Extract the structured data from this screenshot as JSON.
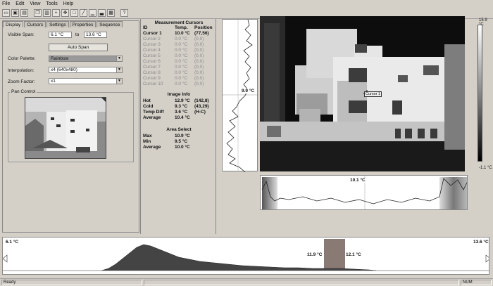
{
  "menu": [
    "File",
    "Edit",
    "View",
    "Tools",
    "Help"
  ],
  "toolbar_icons": [
    "open-icon",
    "save-icon",
    "print-icon",
    "copy-icon",
    "paste-icon",
    "cursor-add-icon",
    "cursor-move-icon",
    "rectangle-icon",
    "line-icon",
    "histogram-icon",
    "histogram-2-icon",
    "palette-icon",
    "help-icon"
  ],
  "tabs": [
    "Display",
    "Cursors",
    "Settings",
    "Properties",
    "Sequence"
  ],
  "display": {
    "visible_span_label": "Visible Span:",
    "span_min": "6.1 °C",
    "to_label": "to",
    "span_max": "13.6 °C",
    "auto_span": "Auto Span",
    "color_palette_label": "Color Palette:",
    "color_palette": "Rainbow",
    "interpolation_label": "Interpolation:",
    "interpolation": "x4 (640x480)",
    "zoom_label": "Zoom Factor:",
    "zoom": "x1",
    "pan_control": "Pan Control"
  },
  "measurement": {
    "title": "Measurement Cursors",
    "headers": [
      "ID",
      "Temp.",
      "Position"
    ],
    "cursors": [
      {
        "id": "Cursor 1",
        "temp": "10.0 °C",
        "pos": "(77,56)",
        "active": true
      },
      {
        "id": "Cursor 2",
        "temp": "0.0 °C",
        "pos": "(0,0)",
        "active": false
      },
      {
        "id": "Cursor 3",
        "temp": "0.0 °C",
        "pos": "(0,0)",
        "active": false
      },
      {
        "id": "Cursor 4",
        "temp": "0.0 °C",
        "pos": "(0,0)",
        "active": false
      },
      {
        "id": "Cursor 5",
        "temp": "0.0 °C",
        "pos": "(0,0)",
        "active": false
      },
      {
        "id": "Cursor 6",
        "temp": "0.0 °C",
        "pos": "(0,0)",
        "active": false
      },
      {
        "id": "Cursor 7",
        "temp": "0.0 °C",
        "pos": "(0,0)",
        "active": false
      },
      {
        "id": "Cursor 8",
        "temp": "0.0 °C",
        "pos": "(0,0)",
        "active": false
      },
      {
        "id": "Cursor 9",
        "temp": "0.0 °C",
        "pos": "(0,0)",
        "active": false
      },
      {
        "id": "Cursor 10",
        "temp": "0.0 °C",
        "pos": "(0,0)",
        "active": false
      }
    ],
    "image_info_title": "Image Info",
    "image_info": [
      {
        "label": "Hot",
        "temp": "12.9 °C",
        "pos": "(142,8)"
      },
      {
        "label": "Cold",
        "temp": "9.3 °C",
        "pos": "(43,29)"
      },
      {
        "label": "Temp Diff",
        "temp": "3.6 °C",
        "pos": "(H-C)"
      },
      {
        "label": "Average",
        "temp": "10.4 °C",
        "pos": ""
      }
    ],
    "area_select_title": "Area Select",
    "area_select": [
      {
        "label": "Max",
        "temp": "10.9 °C"
      },
      {
        "label": "Min",
        "temp": "9.5 °C"
      },
      {
        "label": "Average",
        "temp": "10.0 °C"
      }
    ]
  },
  "vertical_profile_label": "9.9 °C",
  "thermal_cursor_label": "Cursor 1",
  "scale": {
    "max": "15.9 °C",
    "min": "-1.1 °C"
  },
  "horizontal_profile_label": "10.1 °C",
  "histogram": {
    "min_label": "6.1 °C",
    "max_label": "13.6 °C",
    "sel_low": "11.9 °C",
    "sel_high": "12.1 °C"
  },
  "status": {
    "text": "Ready",
    "num": "NUM"
  },
  "colors": {
    "selection": "#8a7a74",
    "background": "#d4d0c8"
  }
}
